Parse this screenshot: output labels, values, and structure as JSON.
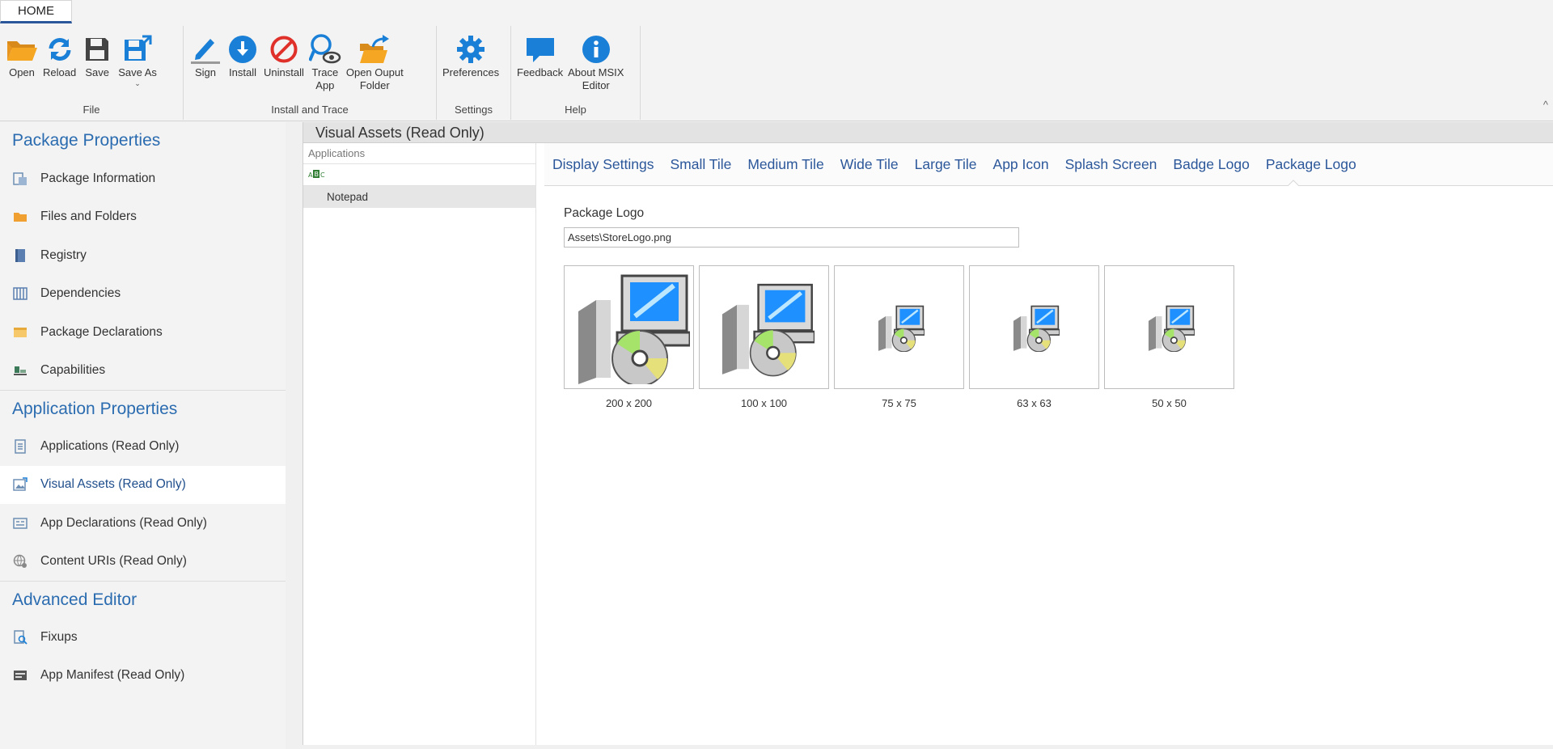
{
  "ribbon": {
    "tab_home": "HOME",
    "groups": [
      {
        "label": "File",
        "buttons": [
          {
            "label": "Open",
            "icon": "folder-open-icon"
          },
          {
            "label": "Reload",
            "icon": "reload-icon"
          },
          {
            "label": "Save",
            "icon": "save-icon"
          },
          {
            "label": "Save As",
            "icon": "save-as-icon"
          }
        ]
      },
      {
        "label": "Install and Trace",
        "buttons": [
          {
            "label": "Sign",
            "icon": "sign-pen-icon"
          },
          {
            "label": "Install",
            "icon": "install-icon"
          },
          {
            "label": "Uninstall",
            "icon": "uninstall-icon"
          },
          {
            "label": "Trace\nApp",
            "icon": "trace-app-icon"
          },
          {
            "label": "Open Ouput\nFolder",
            "icon": "open-output-folder-icon"
          }
        ]
      },
      {
        "label": "Settings",
        "buttons": [
          {
            "label": "Preferences",
            "icon": "gear-icon"
          }
        ]
      },
      {
        "label": "Help",
        "buttons": [
          {
            "label": "Feedback",
            "icon": "feedback-icon"
          },
          {
            "label": "About MSIX\nEditor",
            "icon": "info-icon"
          }
        ]
      }
    ],
    "save_as_chevron": "⌄",
    "collapse_caret": "^"
  },
  "nav": {
    "sections": [
      {
        "title": "Package Properties",
        "items": [
          {
            "label": "Package Information",
            "icon": "package-info-icon"
          },
          {
            "label": "Files and Folders",
            "icon": "folder-icon"
          },
          {
            "label": "Registry",
            "icon": "registry-icon"
          },
          {
            "label": "Dependencies",
            "icon": "dependencies-icon"
          },
          {
            "label": "Package Declarations",
            "icon": "declarations-icon"
          },
          {
            "label": "Capabilities",
            "icon": "capabilities-icon"
          }
        ]
      },
      {
        "title": "Application Properties",
        "items": [
          {
            "label": "Applications (Read Only)",
            "icon": "applications-icon"
          },
          {
            "label": "Visual Assets (Read Only)",
            "icon": "visual-assets-icon",
            "active": true
          },
          {
            "label": "App Declarations (Read Only)",
            "icon": "app-declarations-icon"
          },
          {
            "label": "Content URIs (Read Only)",
            "icon": "content-uris-icon"
          }
        ]
      },
      {
        "title": "Advanced Editor",
        "items": [
          {
            "label": "Fixups",
            "icon": "fixups-icon"
          },
          {
            "label": "App Manifest (Read Only)",
            "icon": "app-manifest-icon"
          }
        ]
      }
    ]
  },
  "main": {
    "title": "Visual Assets (Read Only)",
    "apps_panel": {
      "header": "Applications",
      "filter_icon": "abc-filter-icon",
      "rows": [
        "Notepad"
      ]
    },
    "tabs": [
      "Display Settings",
      "Small Tile",
      "Medium Tile",
      "Wide Tile",
      "Large Tile",
      "App Icon",
      "Splash Screen",
      "Badge Logo",
      "Package Logo"
    ],
    "active_tab": "Package Logo",
    "field_label": "Package Logo",
    "field_value": "Assets\\StoreLogo.png",
    "thumbnails": [
      {
        "caption": "200 x 200",
        "icon": "installer-computer-cd-icon"
      },
      {
        "caption": "100 x 100",
        "icon": "installer-computer-cd-icon"
      },
      {
        "caption": "75 x 75",
        "icon": "installer-computer-cd-icon"
      },
      {
        "caption": "63 x 63",
        "icon": "installer-computer-cd-icon"
      },
      {
        "caption": "50 x 50",
        "icon": "installer-computer-cd-icon"
      }
    ]
  },
  "colors": {
    "accent_blue": "#2b579a",
    "section_blue": "#2b6cb0",
    "icon_orange": "#f0a030",
    "icon_blue": "#1a7fd6",
    "icon_red": "#e0302a"
  }
}
